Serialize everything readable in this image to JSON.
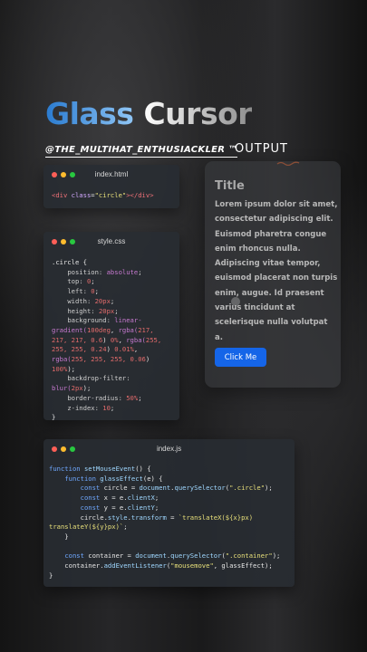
{
  "headline": {
    "word1": "Glass",
    "word2": "Cursor"
  },
  "handle": "@THE_MULTIHAT_ENTHUSIACKLER ™",
  "output_label": "OUTPUT",
  "html_window": {
    "filename": "index.html"
  },
  "css_window": {
    "filename": "style.css"
  },
  "js_window": {
    "filename": "index.js"
  },
  "output": {
    "title": "Title",
    "body": "Lorem ipsum dolor sit amet, consectetur adipiscing elit. Euismod pharetra congue enim rhoncus nulla. Adipiscing vitae tempor, euismod placerat non turpis enim, augue. Id praesent varius tincidunt at scelerisque nulla volutpat a.",
    "button": "Click Me"
  },
  "colors": {
    "blue_button": "#1565e8",
    "dot_red": "#ff5f57",
    "dot_yellow": "#febc2e",
    "dot_green": "#28c840"
  }
}
